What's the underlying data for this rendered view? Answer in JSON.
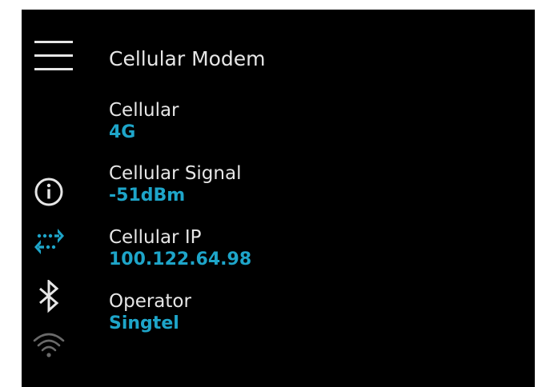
{
  "header": {
    "title": "Cellular Modem",
    "menu_icon": "hamburger-menu-icon"
  },
  "fields": [
    {
      "label": "Cellular",
      "value": "4G"
    },
    {
      "label": "Cellular Signal",
      "value": "-51dBm"
    },
    {
      "label": "Cellular IP",
      "value": "100.122.64.98"
    },
    {
      "label": "Operator",
      "value": "Singtel"
    }
  ],
  "status_icons": [
    {
      "name": "info-icon",
      "color": "#e6e6e6"
    },
    {
      "name": "data-transfer-icon",
      "color": "#1ea5c9"
    },
    {
      "name": "bluetooth-icon",
      "color": "#e6e6e6"
    },
    {
      "name": "wifi-icon",
      "color": "#6a6a6a"
    }
  ],
  "colors": {
    "background": "#000000",
    "text": "#e6e6e6",
    "accent": "#1ea5c9",
    "inactive": "#6a6a6a"
  }
}
